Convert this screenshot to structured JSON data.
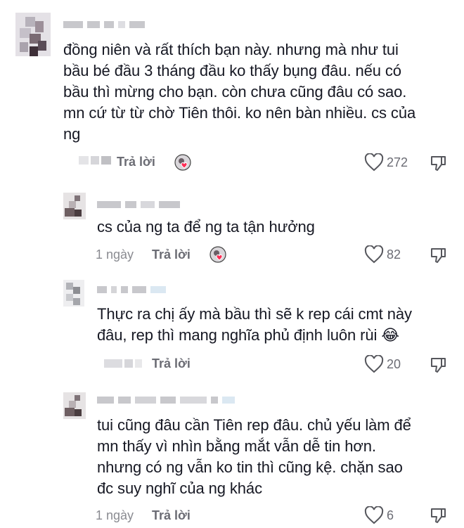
{
  "comments": [
    {
      "text": "đồng niên và rất thích bạn này. nhưng mà như tui\nbầu bé đầu 3 tháng đầu ko thấy bụng đâu. nếu có\nbầu thì mừng cho bạn. còn chưa cũng đâu có sao.\nmn cứ từ từ chờ Tiên thôi. ko nên bàn nhiều. cs của\nng",
      "date": "",
      "reply_label": "Trả lời",
      "likes": "272"
    },
    {
      "text": "cs của ng ta để ng ta tận hưởng",
      "date": "1 ngày",
      "reply_label": "Trả lời",
      "likes": "82"
    },
    {
      "text": "Thực ra chị ấy mà bầu thì sẽ k rep cái cmt này\nđâu, rep thì mang nghĩa phủ định luôn rùi 😂",
      "date": "",
      "reply_label": "Trả lời",
      "likes": "20"
    },
    {
      "text": "tui cũng đâu cần Tiên rep đâu. chủ yếu làm để\nmn thấy vì nhìn bằng mắt vẫn dễ tin hơn.\nnhưng có ng vẫn ko tin thì cũng kệ. chặn sao\nđc suy nghĩ của ng khác",
      "date": "1 ngày",
      "reply_label": "Trả lời",
      "likes": "6"
    }
  ],
  "icons": {
    "like": "heart-outline-icon",
    "dislike": "thumbs-down-icon",
    "creator": "creator-liked-heart-icon"
  },
  "colors": {
    "text": "#161823",
    "secondary": "#8a8b91",
    "heart_badge": "#fe2c55"
  }
}
